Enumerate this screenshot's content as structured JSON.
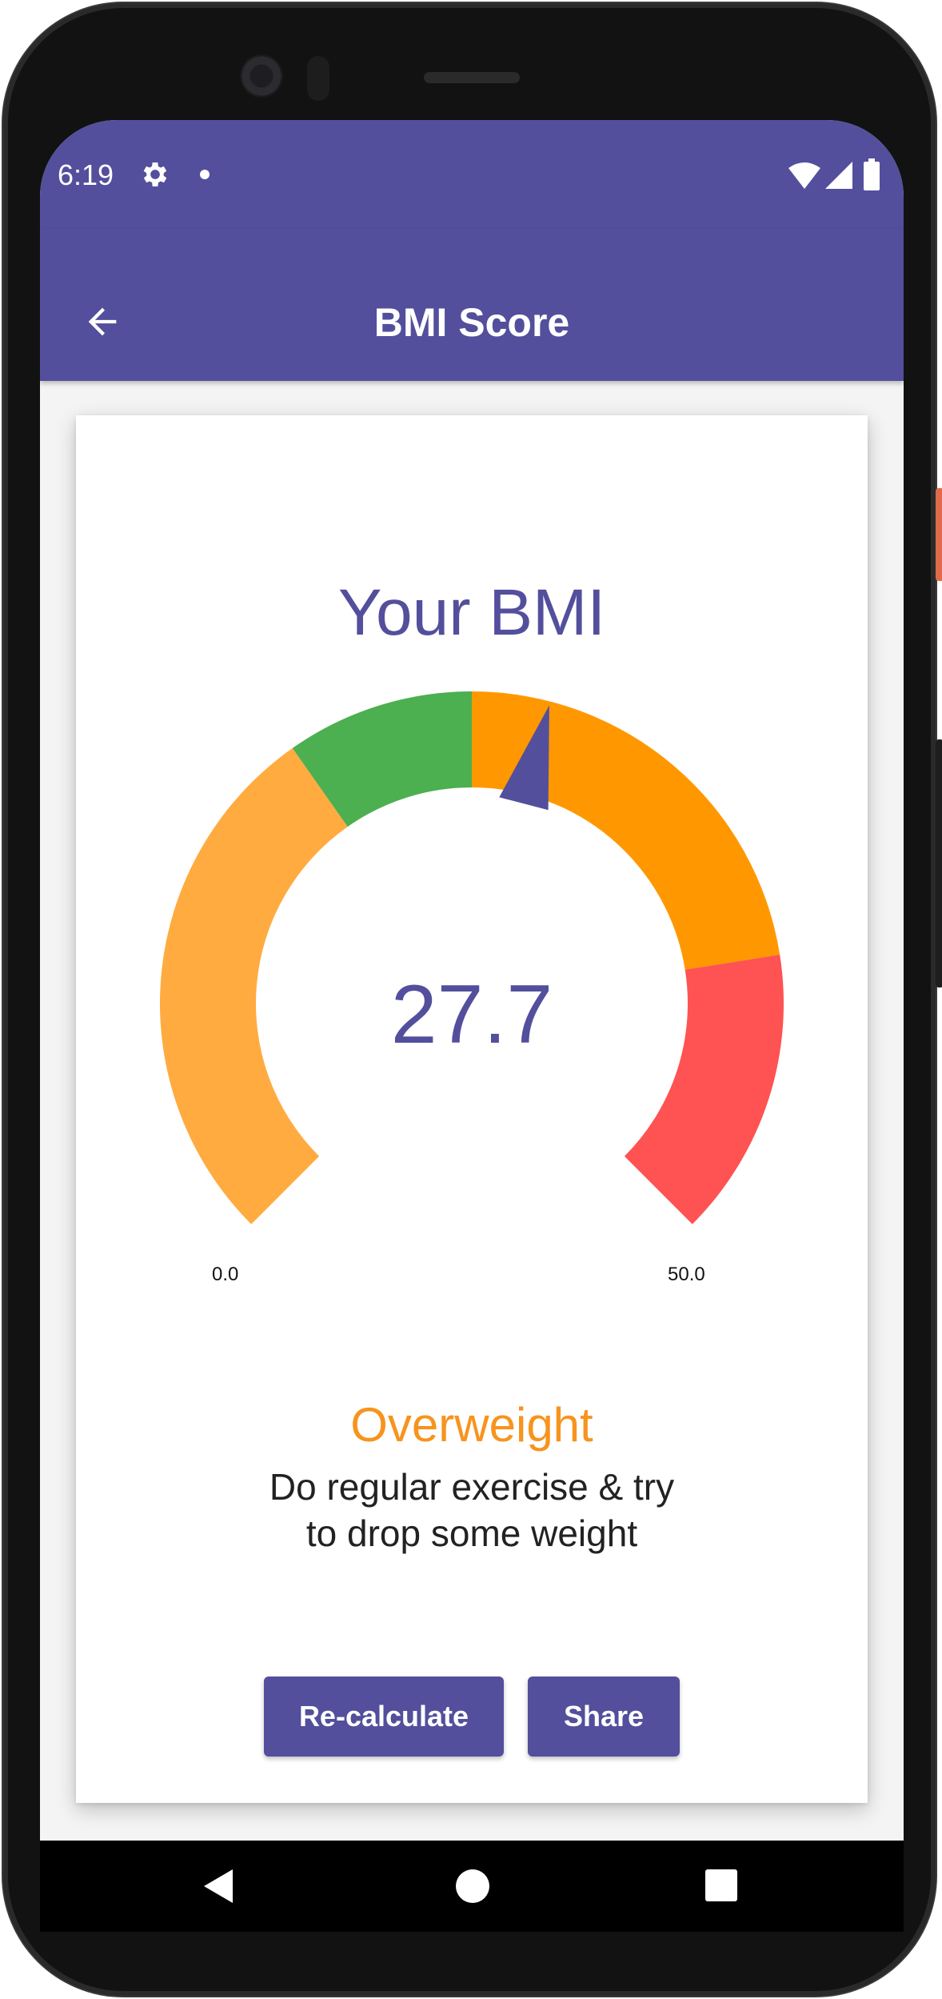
{
  "statusbar": {
    "time": "6:19",
    "icons": [
      "gear-icon",
      "dot-icon",
      "wifi-icon",
      "signal-icon",
      "battery-icon"
    ]
  },
  "appbar": {
    "title": "BMI Score",
    "back_icon": "arrow-back-icon"
  },
  "result": {
    "heading": "Your BMI",
    "bmi_value": "27.7",
    "bmi_number": 27.7,
    "range_min": "0.0",
    "range_max": "50.0",
    "category": "Overweight",
    "advice_line1": "Do regular exercise & try",
    "advice_line2": "to drop some weight"
  },
  "gauge": {
    "min": 0,
    "max": 50,
    "value": 27.7,
    "segments": [
      {
        "from": 0,
        "to": 18.5,
        "color": "#ffab40"
      },
      {
        "from": 18.5,
        "to": 25,
        "color": "#4caf50"
      },
      {
        "from": 25,
        "to": 40,
        "color": "#ff9800"
      },
      {
        "from": 40,
        "to": 50,
        "color": "#ff5252"
      }
    ],
    "needle_color": "#534f9c"
  },
  "buttons": {
    "recalculate": "Re-calculate",
    "share": "Share"
  },
  "colors": {
    "primary": "#534f9c",
    "category": "#f7941d"
  },
  "navbar": {
    "icons": [
      "nav-back-icon",
      "nav-home-icon",
      "nav-recents-icon"
    ]
  }
}
